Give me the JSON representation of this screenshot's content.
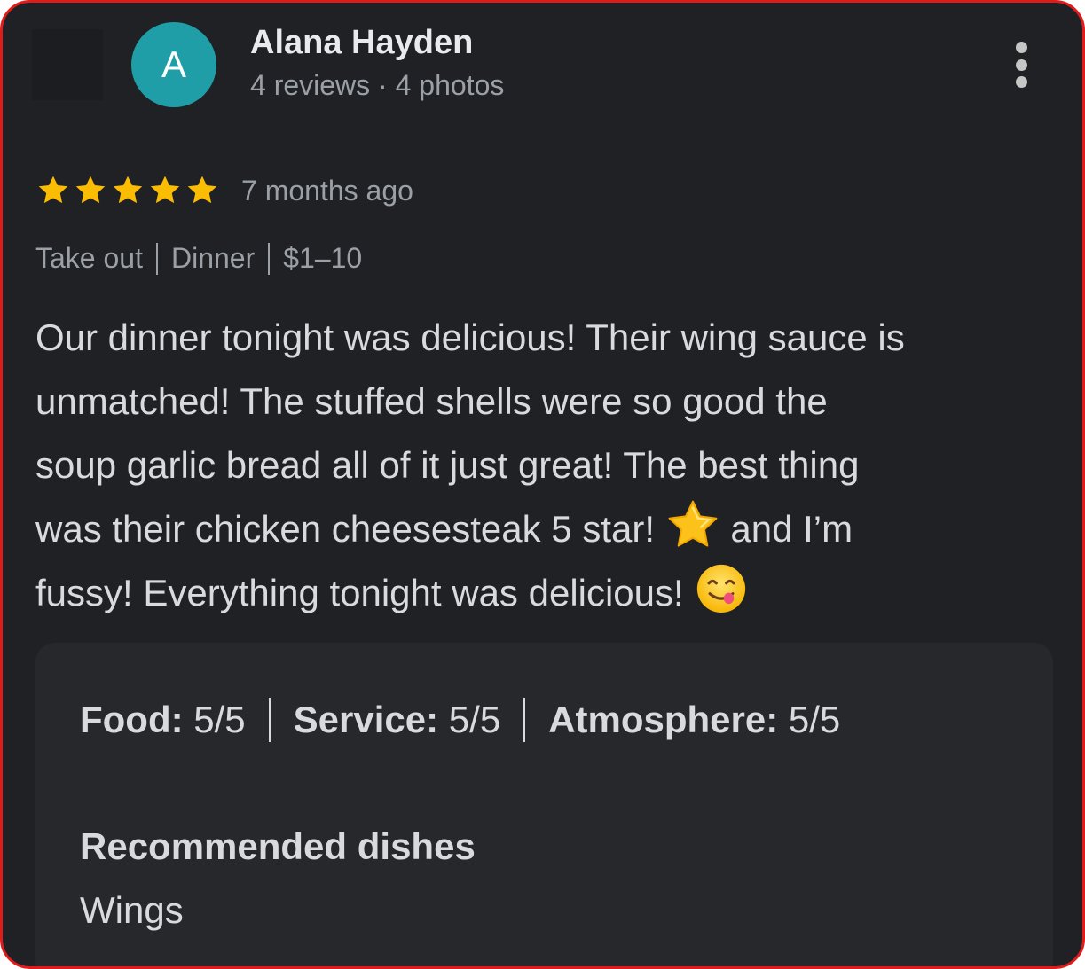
{
  "reviewer": {
    "initial": "A",
    "name": "Alana Hayden",
    "reviews": "4 reviews",
    "separator": "·",
    "photos": "4 photos",
    "avatar_color": "#1f9ea8"
  },
  "rating": {
    "stars": 5,
    "max_stars": 5,
    "star_color": "#fbbc04",
    "date": "7 months ago"
  },
  "attributes": [
    "Take out",
    "Dinner",
    "$1–10"
  ],
  "review_text": {
    "line1": "Our dinner tonight was delicious! Their wing sauce is",
    "line2": "unmatched! The stuffed shells were so good the",
    "line3": "soup garlic bread all of it just great! The best thing",
    "line4_before": "was their chicken cheesesteak 5 star!",
    "line4_after": "and I’m",
    "line5": "fussy! Everything tonight was delicious!",
    "emoji_1": "star-emoji",
    "emoji_2": "yum-face-emoji"
  },
  "scores": {
    "food_label": "Food:",
    "food_value": "5/5",
    "service_label": "Service:",
    "service_value": "5/5",
    "atmosphere_label": "Atmosphere:",
    "atmosphere_value": "5/5"
  },
  "recommended": {
    "heading": "Recommended dishes",
    "value": "Wings"
  },
  "icons": {
    "more": "more-vert-icon",
    "star": "star-icon"
  }
}
